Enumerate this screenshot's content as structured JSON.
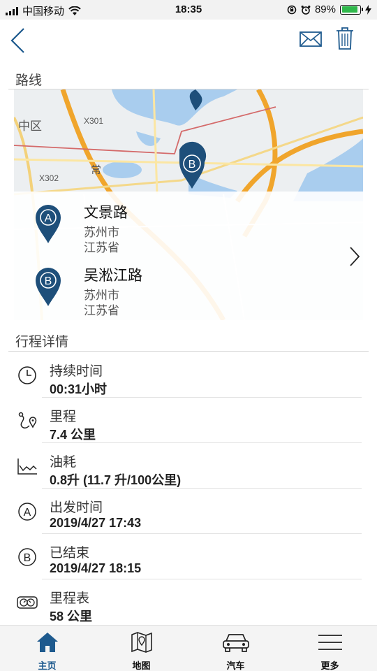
{
  "status_bar": {
    "carrier": "中国移动",
    "time": "18:35",
    "battery": "89%",
    "battery_level": 0.89,
    "battery_color": "#2fb84b"
  },
  "nav": {
    "back_icon": "chevron-left-icon",
    "mail_icon": "mail-icon",
    "delete_icon": "trash-icon"
  },
  "route": {
    "section_title": "路线",
    "map_labels": [
      "中区",
      "X301",
      "X302",
      "常"
    ],
    "start": {
      "marker": "A",
      "name": "文景路",
      "city": "苏州市",
      "province": "江苏省"
    },
    "end": {
      "marker": "B",
      "name": "吴淞江路",
      "city": "苏州市",
      "province": "江苏省"
    }
  },
  "details": {
    "section_title": "行程详情",
    "rows": [
      {
        "icon": "clock-icon",
        "label": "持续时间",
        "value": "00:31小时"
      },
      {
        "icon": "route-icon",
        "label": "里程",
        "value": "7.4 公里"
      },
      {
        "icon": "fuel-chart-icon",
        "label": "油耗",
        "value": "0.8升 (11.7 升/100公里)"
      },
      {
        "icon": "circle-a-icon",
        "label": "出发时间",
        "value": "2019/4/27 17:43"
      },
      {
        "icon": "circle-b-icon",
        "label": "已结束",
        "value": "2019/4/27 18:15"
      },
      {
        "icon": "odometer-icon",
        "label": "里程表",
        "value": "58 公里"
      }
    ]
  },
  "tabbar": {
    "items": [
      {
        "label": "主页",
        "icon": "home-icon",
        "active": true
      },
      {
        "label": "地图",
        "icon": "map-icon",
        "active": false
      },
      {
        "label": "汽车",
        "icon": "car-icon",
        "active": false
      },
      {
        "label": "更多",
        "icon": "menu-icon",
        "active": false
      }
    ]
  },
  "colors": {
    "accent": "#1e5a8e",
    "pin": "#1e4f7a"
  }
}
